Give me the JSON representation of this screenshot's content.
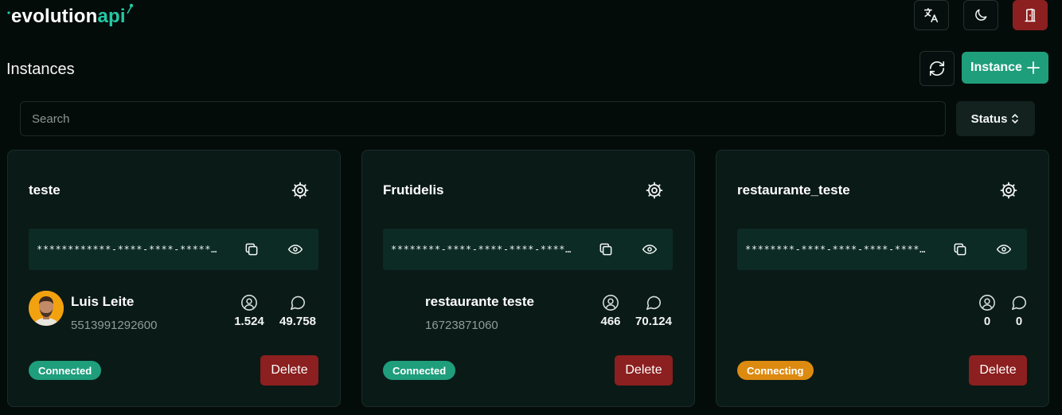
{
  "app": {
    "logo_part1": "evolution",
    "logo_part2": "api",
    "accent_color": "#1f9e7c",
    "danger_color": "#8c1f1f"
  },
  "header": {
    "translate_icon": "translate-icon",
    "theme_icon": "moon-icon",
    "logout_icon": "door-exit-icon"
  },
  "page": {
    "title": "Instances",
    "create_button": "Instance",
    "refresh_icon": "refresh-icon"
  },
  "filters": {
    "search_placeholder": "Search",
    "search_value": "",
    "status_label": "Status"
  },
  "instances": [
    {
      "name": "teste",
      "token": "************-****-****-************",
      "profile_name": "Luis Leite",
      "profile_number": "5513991292600",
      "has_avatar": true,
      "contacts": "1.524",
      "messages": "49.758",
      "status": "Connected",
      "status_color": "#1f9e7c",
      "delete_label": "Delete"
    },
    {
      "name": "Frutidelis",
      "token": "********-****-****-****-************",
      "profile_name": "restaurante teste",
      "profile_number": "16723871060",
      "has_avatar": false,
      "contacts": "466",
      "messages": "70.124",
      "status": "Connected",
      "status_color": "#1f9e7c",
      "delete_label": "Delete"
    },
    {
      "name": "restaurante_teste",
      "token": "********-****-****-****-************",
      "profile_name": "",
      "profile_number": "",
      "has_avatar": false,
      "contacts": "0",
      "messages": "0",
      "status": "Connecting",
      "status_color": "#dc8a10",
      "delete_label": "Delete"
    }
  ]
}
